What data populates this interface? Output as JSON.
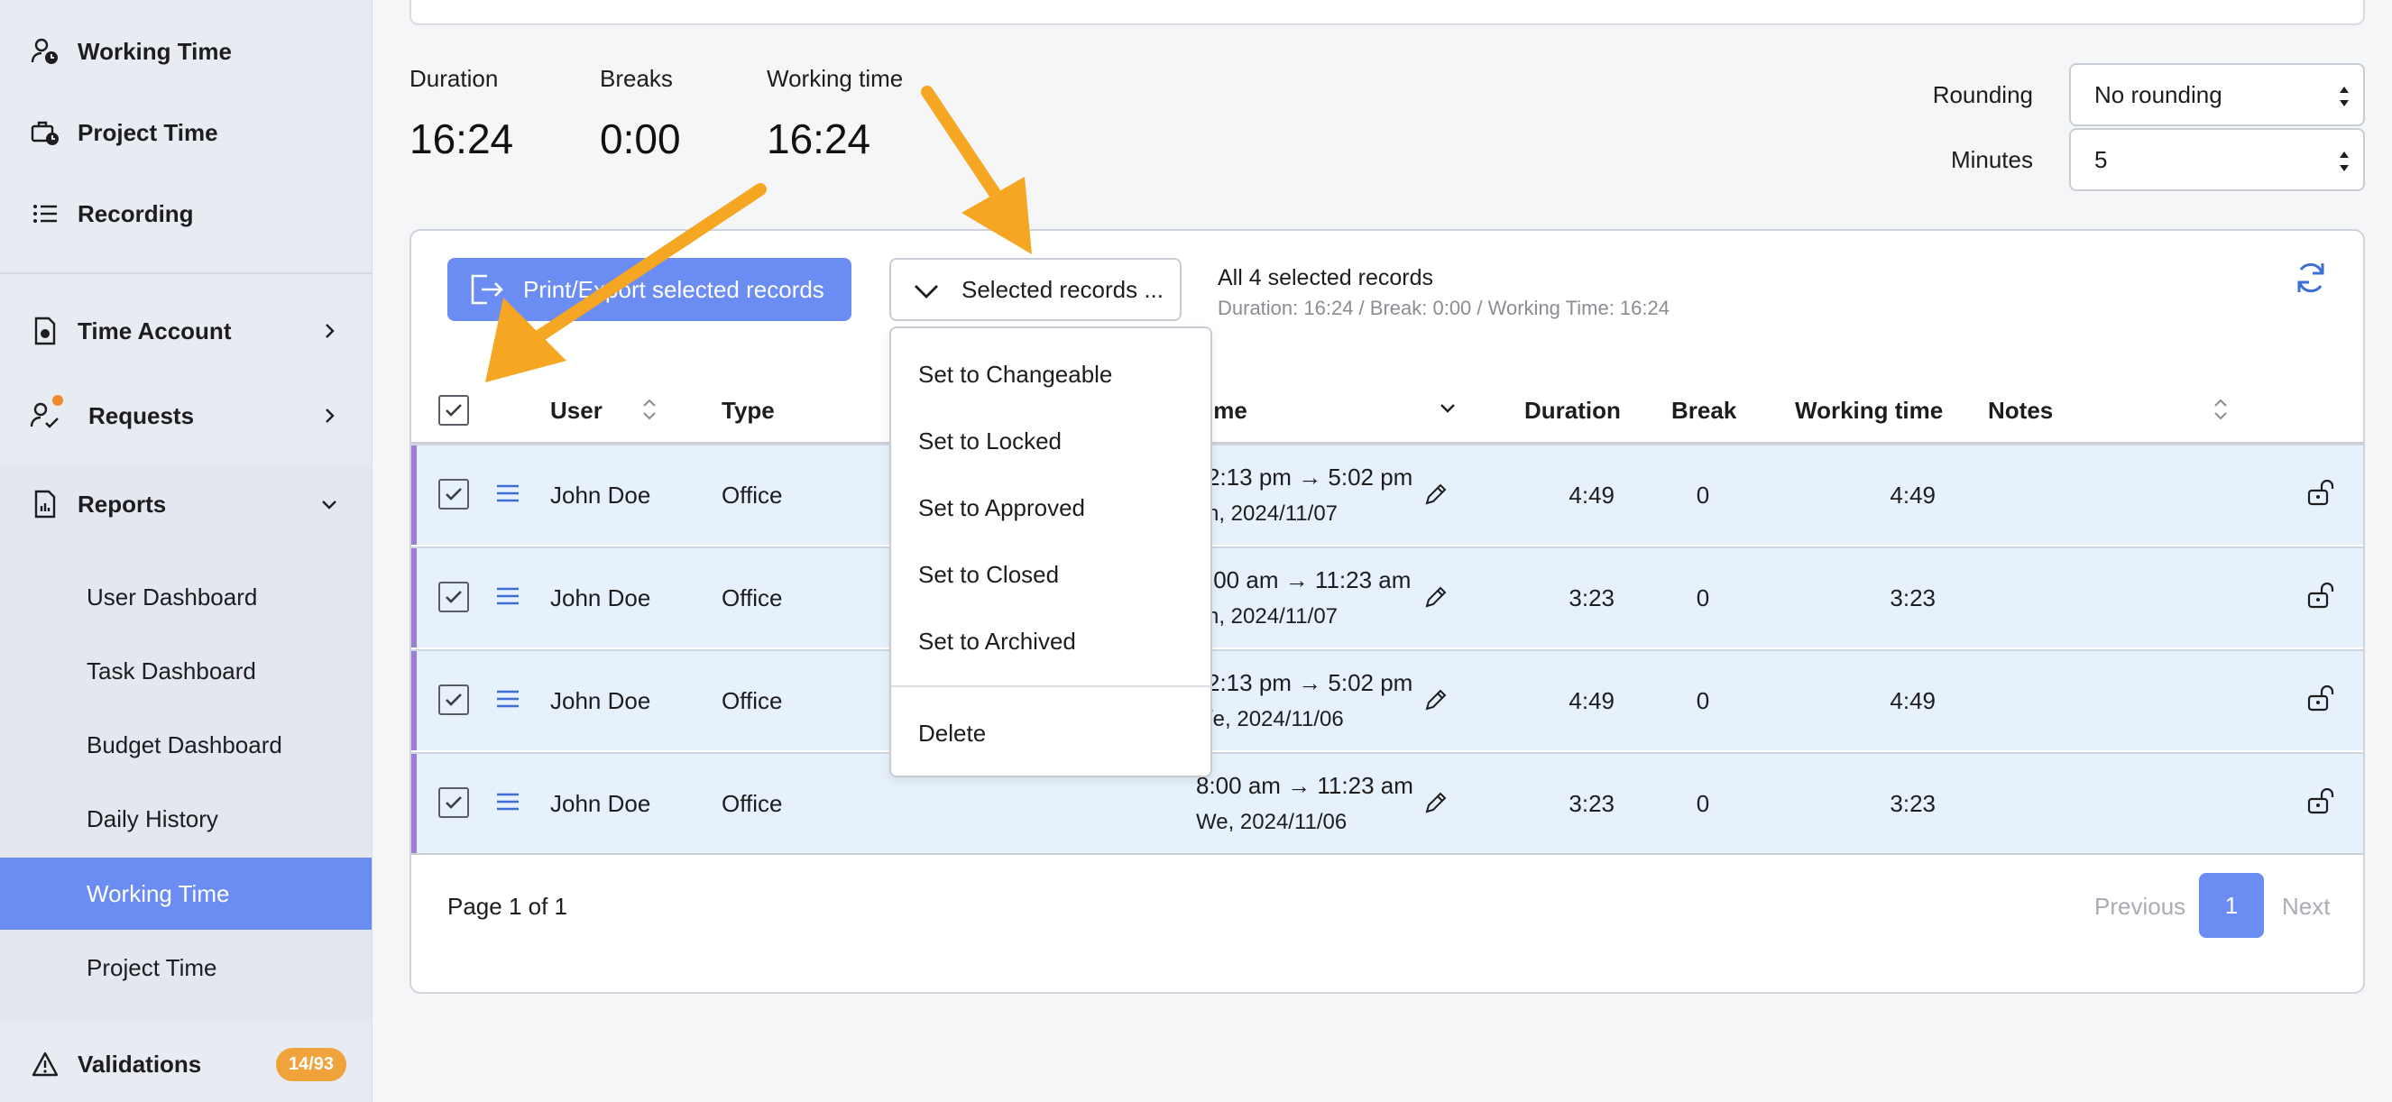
{
  "sidebar": {
    "top_items": [
      {
        "label": "Working Time",
        "icon": "user-clock-icon"
      },
      {
        "label": "Project Time",
        "icon": "briefcase-clock-icon"
      },
      {
        "label": "Recording",
        "icon": "list-icon"
      }
    ],
    "time_account": {
      "label": "Time Account",
      "icon": "clock-document-icon"
    },
    "requests": {
      "label": "Requests",
      "icon": "user-check-icon"
    },
    "reports": {
      "label": "Reports",
      "icon": "report-icon"
    },
    "report_items": [
      {
        "label": "User Dashboard"
      },
      {
        "label": "Task Dashboard"
      },
      {
        "label": "Budget Dashboard"
      },
      {
        "label": "Daily History"
      },
      {
        "label": "Working Time",
        "active": true
      },
      {
        "label": "Project Time"
      }
    ],
    "validations": {
      "label": "Validations",
      "badge": "14/93",
      "icon": "warning-icon"
    }
  },
  "stats": {
    "duration": {
      "label": "Duration",
      "value": "16:24"
    },
    "breaks": {
      "label": "Breaks",
      "value": "0:00"
    },
    "working_time": {
      "label": "Working time",
      "value": "16:24"
    }
  },
  "options": {
    "rounding_label": "Rounding",
    "rounding_value": "No rounding",
    "minutes_label": "Minutes",
    "minutes_value": "5"
  },
  "toolbar": {
    "export_label": "Print/Export selected records",
    "selected_label": "Selected records ...",
    "summary_main": "All 4 selected records",
    "summary_sub": "Duration: 16:24 / Break: 0:00 / Working Time: 16:24"
  },
  "table": {
    "headers": {
      "user": "User",
      "type": "Type",
      "time": "ime",
      "duration": "Duration",
      "break": "Break",
      "working_time": "Working time",
      "notes": "Notes"
    },
    "rows": [
      {
        "user": "John Doe",
        "type": "Office",
        "time_range": "2:13 pm → 5:02 pm",
        "date": "h, 2024/11/07",
        "duration": "4:49",
        "break": "0",
        "working_time": "4:49"
      },
      {
        "user": "John Doe",
        "type": "Office",
        "time_range": ":00 am → 11:23 am",
        "date": "h, 2024/11/07",
        "duration": "3:23",
        "break": "0",
        "working_time": "3:23"
      },
      {
        "user": "John Doe",
        "type": "Office",
        "time_range": "2:13 pm → 5:02 pm",
        "date": "/e, 2024/11/06",
        "duration": "4:49",
        "break": "0",
        "working_time": "4:49"
      },
      {
        "user": "John Doe",
        "type": "Office",
        "time_range": "8:00 am → 11:23 am",
        "date": "We, 2024/11/06",
        "duration": "3:23",
        "break": "0",
        "working_time": "3:23"
      }
    ]
  },
  "dropdown": {
    "items": [
      "Set to Changeable",
      "Set to Locked",
      "Set to Approved",
      "Set to Closed",
      "Set to Archived"
    ],
    "delete": "Delete"
  },
  "pagination": {
    "page_text": "Page 1 of 1",
    "previous": "Previous",
    "current": "1",
    "next": "Next"
  },
  "colors": {
    "accent": "#6b8cf2",
    "annotation_arrow": "#f5a623",
    "row_bg": "#e6f1fb",
    "row_stripe": "#9b7fd0",
    "badge": "#f0a23b"
  }
}
